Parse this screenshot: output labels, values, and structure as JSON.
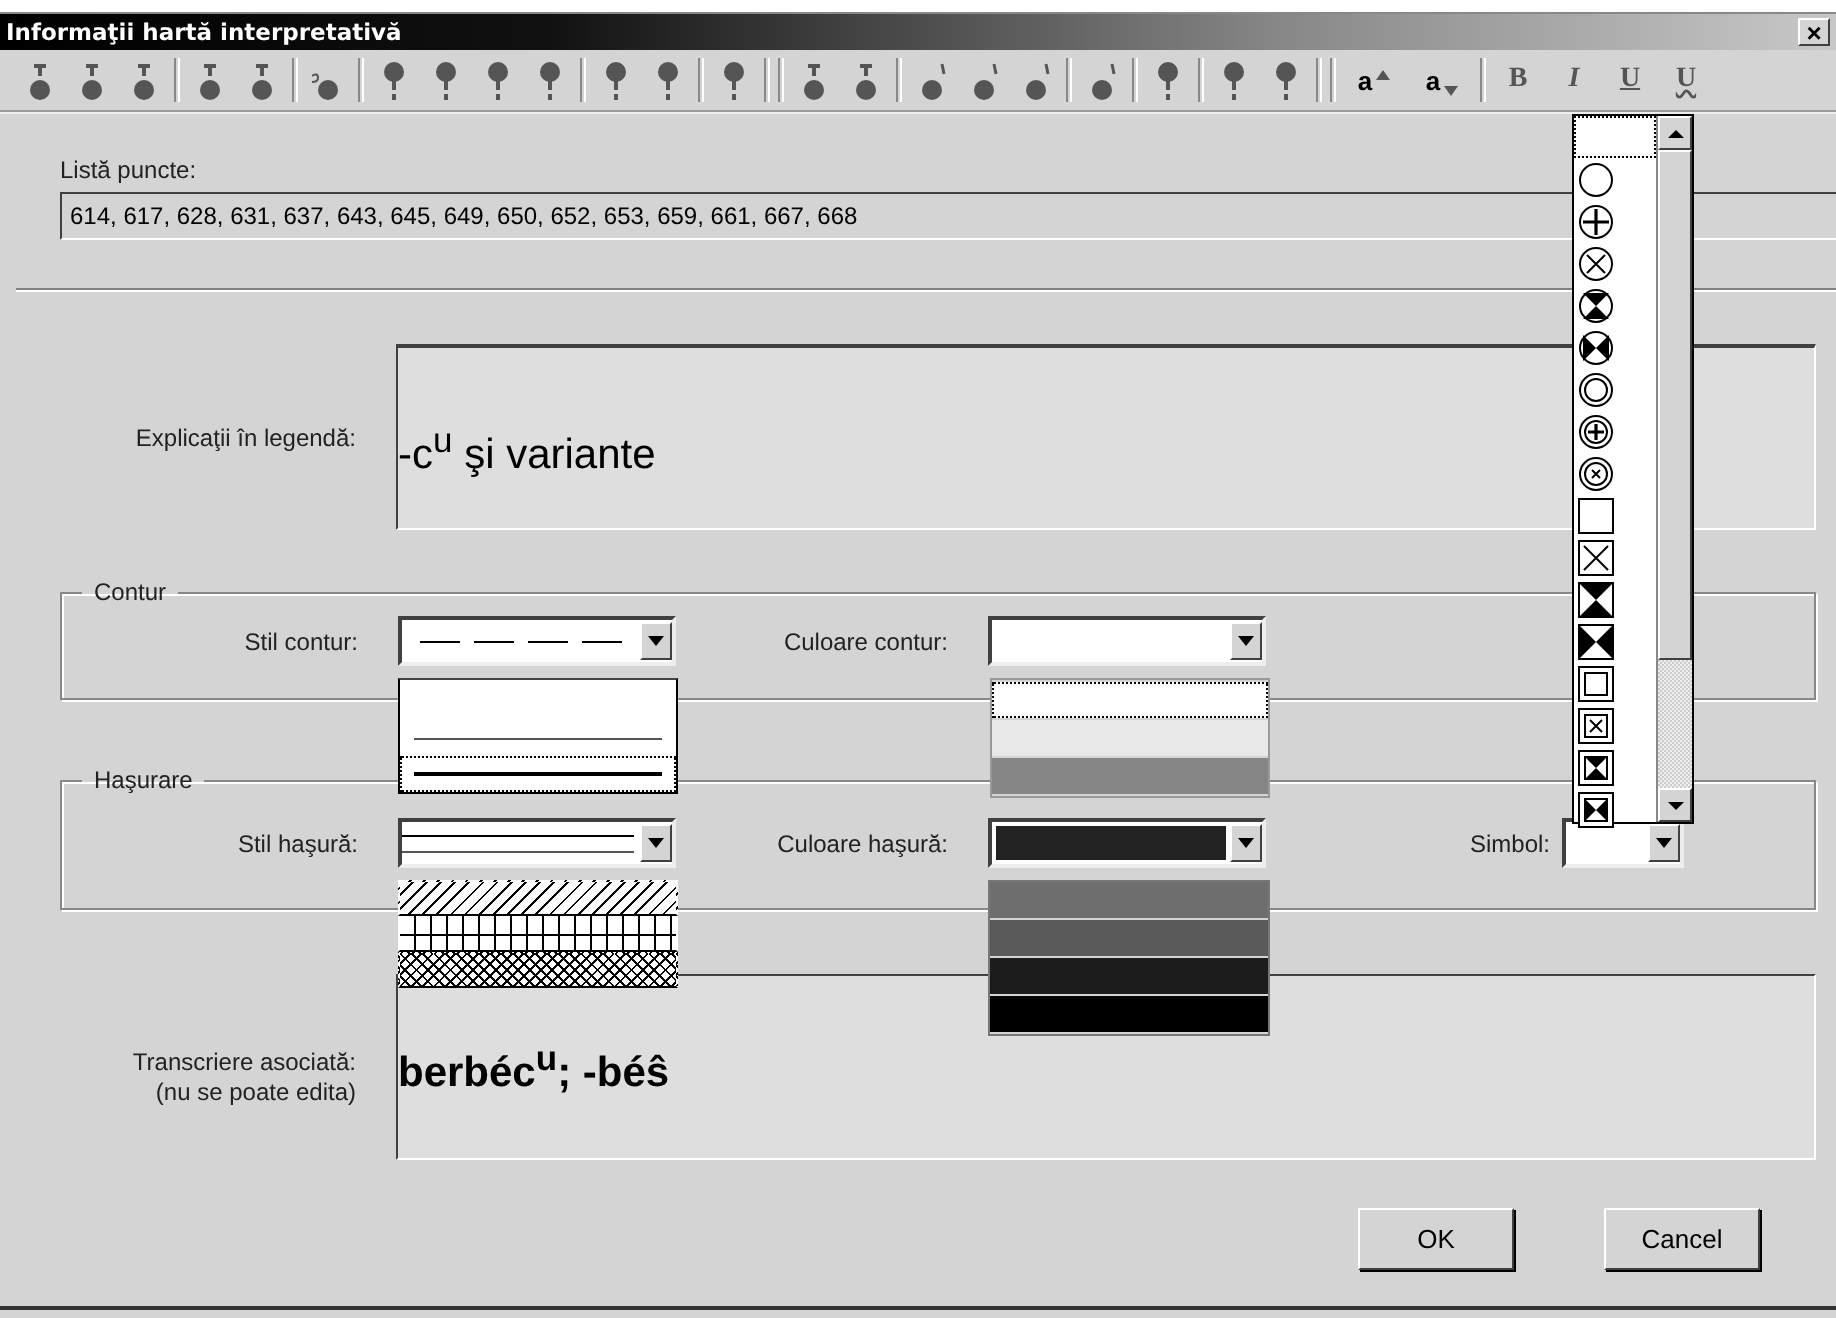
{
  "window": {
    "title": "Informaţii hartă interpretativă",
    "close": "×"
  },
  "toolbar": [
    {
      "kind": "dot-above"
    },
    {
      "kind": "dot-above"
    },
    {
      "kind": "dot-above"
    },
    {
      "kind": "sep"
    },
    {
      "kind": "dot-above"
    },
    {
      "kind": "dot-above"
    },
    {
      "kind": "sep"
    },
    {
      "kind": "dot-before"
    },
    {
      "kind": "sep"
    },
    {
      "kind": "dot-stem"
    },
    {
      "kind": "dot-stem"
    },
    {
      "kind": "dot-stem"
    },
    {
      "kind": "dot-stem"
    },
    {
      "kind": "sep"
    },
    {
      "kind": "dot-stem"
    },
    {
      "kind": "dot-stem"
    },
    {
      "kind": "sep"
    },
    {
      "kind": "dot-stem"
    },
    {
      "kind": "sep"
    },
    {
      "kind": "sep"
    },
    {
      "kind": "dot-above"
    },
    {
      "kind": "dot-above"
    },
    {
      "kind": "sep"
    },
    {
      "kind": "dot-after"
    },
    {
      "kind": "dot-after"
    },
    {
      "kind": "dot-after"
    },
    {
      "kind": "sep"
    },
    {
      "kind": "dot-after"
    },
    {
      "kind": "sep"
    },
    {
      "kind": "dot-stem"
    },
    {
      "kind": "sep"
    },
    {
      "kind": "dot-stem"
    },
    {
      "kind": "dot-stem"
    },
    {
      "kind": "sep"
    },
    {
      "kind": "sep"
    },
    {
      "kind": "raise",
      "label": "a"
    },
    {
      "kind": "lower",
      "label": "a"
    },
    {
      "kind": "sep"
    },
    {
      "kind": "bold",
      "label": "B"
    },
    {
      "kind": "italic",
      "label": "I"
    },
    {
      "kind": "underline",
      "label": "U"
    },
    {
      "kind": "wavy",
      "label": "U"
    }
  ],
  "points": {
    "label": "Listă puncte:",
    "value": "614, 617, 628, 631, 637, 643, 645, 649, 650, 652, 653, 659, 661, 667, 668"
  },
  "legend": {
    "label": "Explicaţii în legendă:",
    "value": "-c$^{u}$ şi variante"
  },
  "contour": {
    "legend": "Contur",
    "style_label": "Stil contur:",
    "current_style": {
      "kind": "dashed"
    },
    "style_options": [
      {
        "kind": "thin",
        "selected": false
      },
      {
        "kind": "thick",
        "selected": true
      }
    ],
    "color_label": "Culoare contur:",
    "current_color": {
      "color": "#ffffff"
    },
    "color_options": [
      {
        "color": "#ffffff",
        "selected": true
      },
      {
        "color": "#e8e8e8",
        "selected": false
      },
      {
        "color": "#858585",
        "selected": false
      }
    ]
  },
  "hatching": {
    "legend": "Haşurare",
    "style_label": "Stil haşură:",
    "current_style": {
      "kind": "double"
    },
    "style_options": [
      {
        "kind": "diagonal"
      },
      {
        "kind": "grid"
      },
      {
        "kind": "crosshatch"
      }
    ],
    "color_label": "Culoare haşură:",
    "current_color": {
      "color": "#222222"
    },
    "color_options": [
      {
        "color": "#6e6e6e"
      },
      {
        "color": "#5a5a5a"
      },
      {
        "color": "#1c1c1c"
      },
      {
        "color": "#000000"
      }
    ],
    "symbol_label": "Simbol:",
    "symbol_options": [
      {
        "kind": "none",
        "selected": true
      },
      {
        "kind": "circle",
        "selected": false
      },
      {
        "kind": "circle-plus",
        "selected": false
      },
      {
        "kind": "circle-cross",
        "selected": false
      },
      {
        "kind": "circle-hourglass",
        "selected": false
      },
      {
        "kind": "circle-bowtie",
        "selected": false
      },
      {
        "kind": "double-circle",
        "selected": false
      },
      {
        "kind": "double-circle-plus",
        "selected": false
      },
      {
        "kind": "double-circle-cross",
        "selected": false
      },
      {
        "kind": "square",
        "selected": false
      },
      {
        "kind": "square-cross",
        "selected": false
      },
      {
        "kind": "square-hourglass",
        "selected": false
      },
      {
        "kind": "square-bowtie",
        "selected": false
      },
      {
        "kind": "double-square",
        "selected": false
      },
      {
        "kind": "double-square-cross",
        "selected": false
      },
      {
        "kind": "double-square-hourglass",
        "selected": false
      },
      {
        "kind": "double-square-bowtie",
        "selected": false
      }
    ]
  },
  "transcription": {
    "label": "Transcriere asociată:",
    "note": "(nu se poate edita)",
    "value": "berbéc$^{u}$; -béŝ"
  },
  "buttons": [
    "OK",
    "Cancel"
  ]
}
